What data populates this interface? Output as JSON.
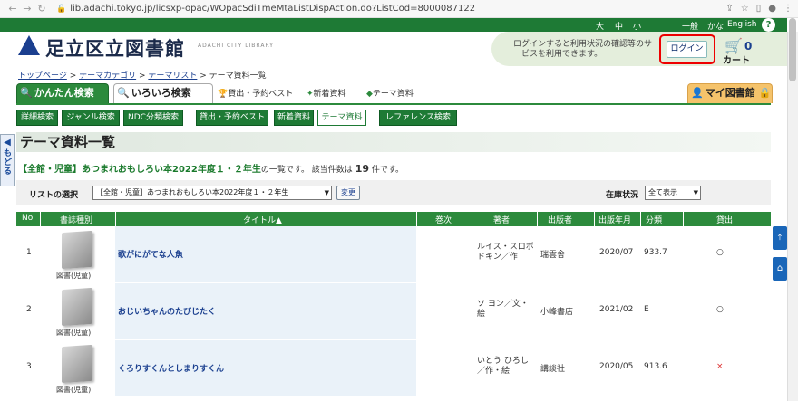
{
  "browser": {
    "url": "lib.adachi.tokyo.jp/licsxp-opac/WOpacSdiTmeMtaListDispAction.do?ListCod=8000087122"
  },
  "gbar": {
    "large": "大",
    "medium": "中",
    "small": "小",
    "normal": "一般",
    "kana": "かな",
    "english": "English",
    "help": "?"
  },
  "header": {
    "logo": "足立区立図書館",
    "logo_sub": "ADACHI CITY LIBRARY"
  },
  "login": {
    "message": "ログインすると利用状況の確認等のサービスを利用できます。",
    "button": "ログイン"
  },
  "cart": {
    "count": "0",
    "label": "カート"
  },
  "breadcrumb": {
    "top": "トップページ",
    "sep": " > ",
    "category": "テーマカテゴリ",
    "list": "テーマリスト",
    "current": "テーマ資料一覧"
  },
  "tabs": {
    "kantan": "かんたん検索",
    "iroiro": "いろいろ検索",
    "best": "貸出・予約ベスト",
    "new": "新着資料",
    "theme": "テーマ資料",
    "mylib": "マイ図書館"
  },
  "subnav": [
    "詳細検索",
    "ジャンル検索",
    "NDC分類検索",
    "貸出・予約ベスト",
    "新着資料",
    "テーマ資料",
    "レファレンス検索"
  ],
  "back": {
    "label": "もどる"
  },
  "page_title": "テーマ資料一覧",
  "summary": {
    "category": "【全館・児童】あつまれおもしろい本2022年度１・２年生",
    "text_a": "の一覧です。 該当件数は",
    "count": "19",
    "text_b": "件です。"
  },
  "list_select": {
    "label": "リストの選択",
    "value": "【全館・児童】あつまれおもしろい本2022年度１・２年生",
    "button": "変更"
  },
  "stock": {
    "label": "在庫状況",
    "value": "全て表示"
  },
  "table": {
    "headers": [
      "No.",
      "書誌種別",
      "タイトル▲",
      "巻次",
      "著者",
      "出版者",
      "出版年月",
      "分類",
      "貸出"
    ],
    "rows": [
      {
        "no": "1",
        "type": "図書(児童)",
        "title": "歌がにがてな人魚",
        "author": "ルイス・スロボドキン／作",
        "publisher": "瑞雲舎",
        "date": "2020/07",
        "class": "933.7",
        "status": "○"
      },
      {
        "no": "2",
        "type": "図書(児童)",
        "title": "おじいちゃんのたびじたく",
        "author": "ソ ヨン／文・絵",
        "publisher": "小峰書店",
        "date": "2021/02",
        "class": "E",
        "status": "○"
      },
      {
        "no": "3",
        "type": "図書(児童)",
        "title": "くろりすくんとしまりすくん",
        "author": "いとう ひろし／作・絵",
        "publisher": "講談社",
        "date": "2020/05",
        "class": "913.6",
        "status": "×"
      }
    ]
  },
  "colors": {
    "green": "#2c8a3c",
    "dark_green": "#1e7a35",
    "navy": "#1b3f8f",
    "red": "#e00000"
  }
}
